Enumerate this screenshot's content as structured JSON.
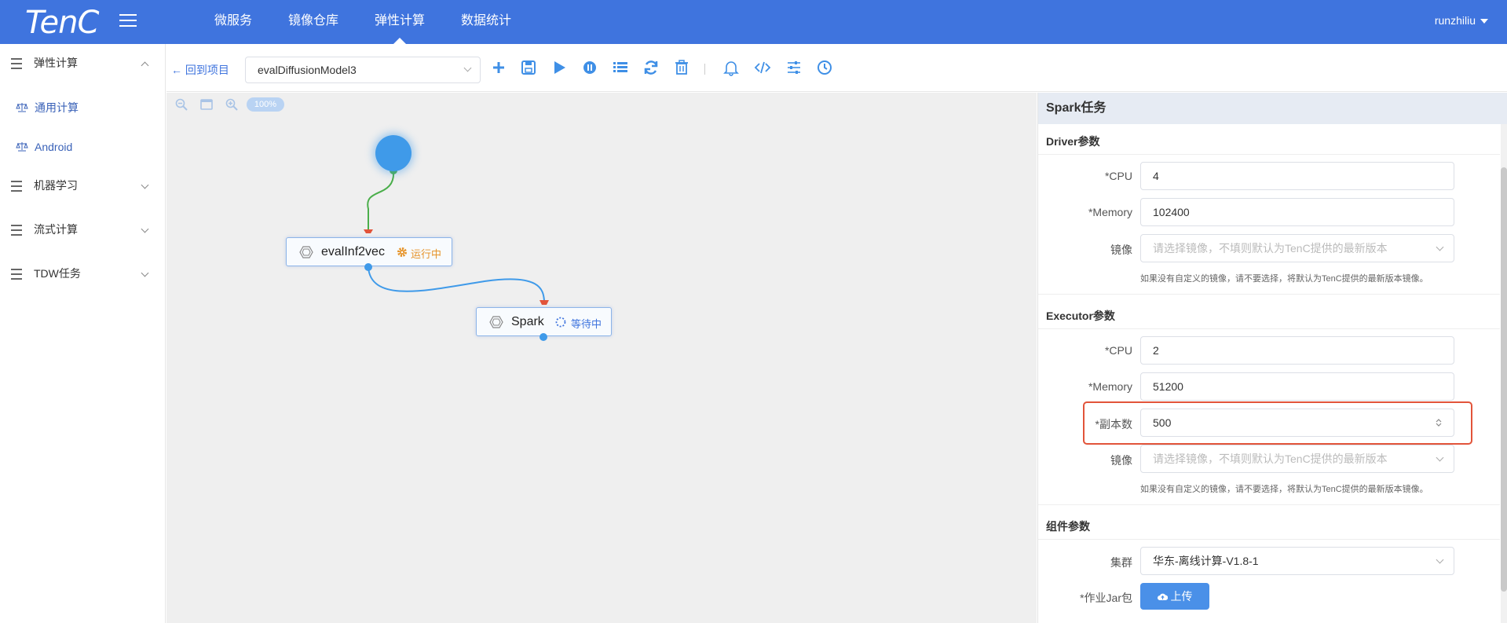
{
  "app": {
    "logo": "TenC",
    "user": "runzhiliu"
  },
  "nav": {
    "items": [
      "微服务",
      "镜像仓库",
      "弹性计算",
      "数据统计"
    ],
    "active": 2
  },
  "sidebar": {
    "group_elastic": "弹性计算",
    "sub_general": "通用计算",
    "sub_android": "Android",
    "group_ml": "机器学习",
    "group_stream": "流式计算",
    "group_tdw": "TDW任务"
  },
  "toolbar": {
    "back_label": "回到项目",
    "project": "evalDiffusionModel3"
  },
  "canvas": {
    "zoom": "100%",
    "node1": {
      "title": "evalInf2vec",
      "status": "运行中",
      "status_color": "#e6942a"
    },
    "node2": {
      "title": "Spark",
      "status": "等待中",
      "status_color": "#3f74de"
    }
  },
  "panel": {
    "title": "Spark任务",
    "driver": {
      "title": "Driver参数",
      "cpu_label": "*CPU",
      "cpu_value": "4",
      "memory_label": "*Memory",
      "memory_value": "102400",
      "image_label": "镜像",
      "image_placeholder": "请选择镜像，不填则默认为TenC提供的最新版本",
      "hint": "如果没有自定义的镜像，请不要选择，将默认为TenC提供的最新版本镜像。"
    },
    "executor": {
      "title": "Executor参数",
      "cpu_label": "*CPU",
      "cpu_value": "2",
      "memory_label": "*Memory",
      "memory_value": "51200",
      "replicas_label": "*副本数",
      "replicas_value": "500",
      "image_label": "镜像",
      "image_placeholder": "请选择镜像，不填则默认为TenC提供的最新版本",
      "hint": "如果没有自定义的镜像，请不要选择，将默认为TenC提供的最新版本镜像。"
    },
    "component": {
      "title": "组件参数",
      "cluster_label": "集群",
      "cluster_value": "华东-离线计算-V1.8-1",
      "jar_label": "*作业Jar包",
      "upload_label": "上传"
    }
  }
}
